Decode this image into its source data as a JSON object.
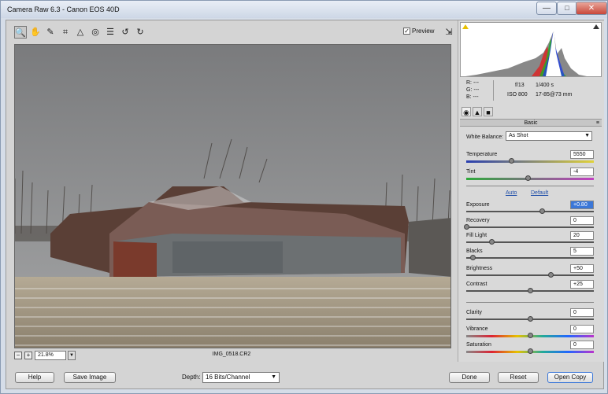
{
  "window": {
    "title": "Camera Raw 6.3  -  Canon EOS 40D",
    "minimize": "—",
    "maximize": "□",
    "close": "✕"
  },
  "toolbar": {
    "tools": [
      {
        "name": "zoom-tool-icon",
        "glyph": "🔍"
      },
      {
        "name": "hand-tool-icon",
        "glyph": "✋"
      },
      {
        "name": "white-balance-tool-icon",
        "glyph": "✎"
      },
      {
        "name": "crop-tool-icon",
        "glyph": "⌗"
      },
      {
        "name": "straighten-tool-icon",
        "glyph": "△"
      },
      {
        "name": "red-eye-tool-icon",
        "glyph": "◎"
      },
      {
        "name": "preferences-icon",
        "glyph": "☰"
      },
      {
        "name": "rotate-left-icon",
        "glyph": "↺"
      },
      {
        "name": "rotate-right-icon",
        "glyph": "↻"
      }
    ],
    "preview_label": "Preview",
    "preview_checked": "✓",
    "fullscreen_glyph": "⇲"
  },
  "image": {
    "filename": "IMG_0518.CR2",
    "zoom": "21.8%",
    "zoom_out": "−",
    "zoom_in": "+",
    "zoom_dropdown": "▼"
  },
  "histogram": {
    "r": "R:  ---",
    "g": "G:  ---",
    "b": "B:  ---",
    "aperture": "f/13",
    "shutter": "1/400 s",
    "iso": "ISO 800",
    "lens": "17-85@73 mm"
  },
  "panel": {
    "section_title": "Basic",
    "white_balance_label": "White Balance:",
    "white_balance_value": "As Shot",
    "auto_label": "Auto",
    "default_label": "Default",
    "controls": [
      {
        "label": "Temperature",
        "value": "5550",
        "level": 0.35,
        "track": "linear-gradient(90deg,#2a3fb0,#e0d23a)"
      },
      {
        "label": "Tint",
        "value": "-4",
        "level": 0.48,
        "track": "linear-gradient(90deg,#2eaa3a,#c23fc1)"
      },
      {
        "label": "Exposure",
        "value": "+0.80",
        "level": 0.59,
        "highlight": true
      },
      {
        "label": "Recovery",
        "value": "0",
        "level": 0.0
      },
      {
        "label": "Fill Light",
        "value": "20",
        "level": 0.2
      },
      {
        "label": "Blacks",
        "value": "5",
        "level": 0.05
      },
      {
        "label": "Brightness",
        "value": "+50",
        "level": 0.66
      },
      {
        "label": "Contrast",
        "value": "+25",
        "level": 0.5
      },
      {
        "label": "Clarity",
        "value": "0",
        "level": 0.5
      },
      {
        "label": "Vibrance",
        "value": "0",
        "level": 0.5,
        "track": "linear-gradient(90deg,#888,#d23,#e6c200,#2a9,#26f,#b3c)"
      },
      {
        "label": "Saturation",
        "value": "0",
        "level": 0.5,
        "track": "linear-gradient(90deg,#888,#d23,#e6c200,#2a9,#26f,#b3c)"
      }
    ]
  },
  "footer": {
    "help": "Help",
    "save_image": "Save Image",
    "depth_label": "Depth:",
    "depth_value": "16 Bits/Channel",
    "done": "Done",
    "reset": "Reset",
    "open_copy": "Open Copy"
  },
  "colors": {
    "accent": "#3b77d8",
    "link": "#1f4ea8"
  }
}
